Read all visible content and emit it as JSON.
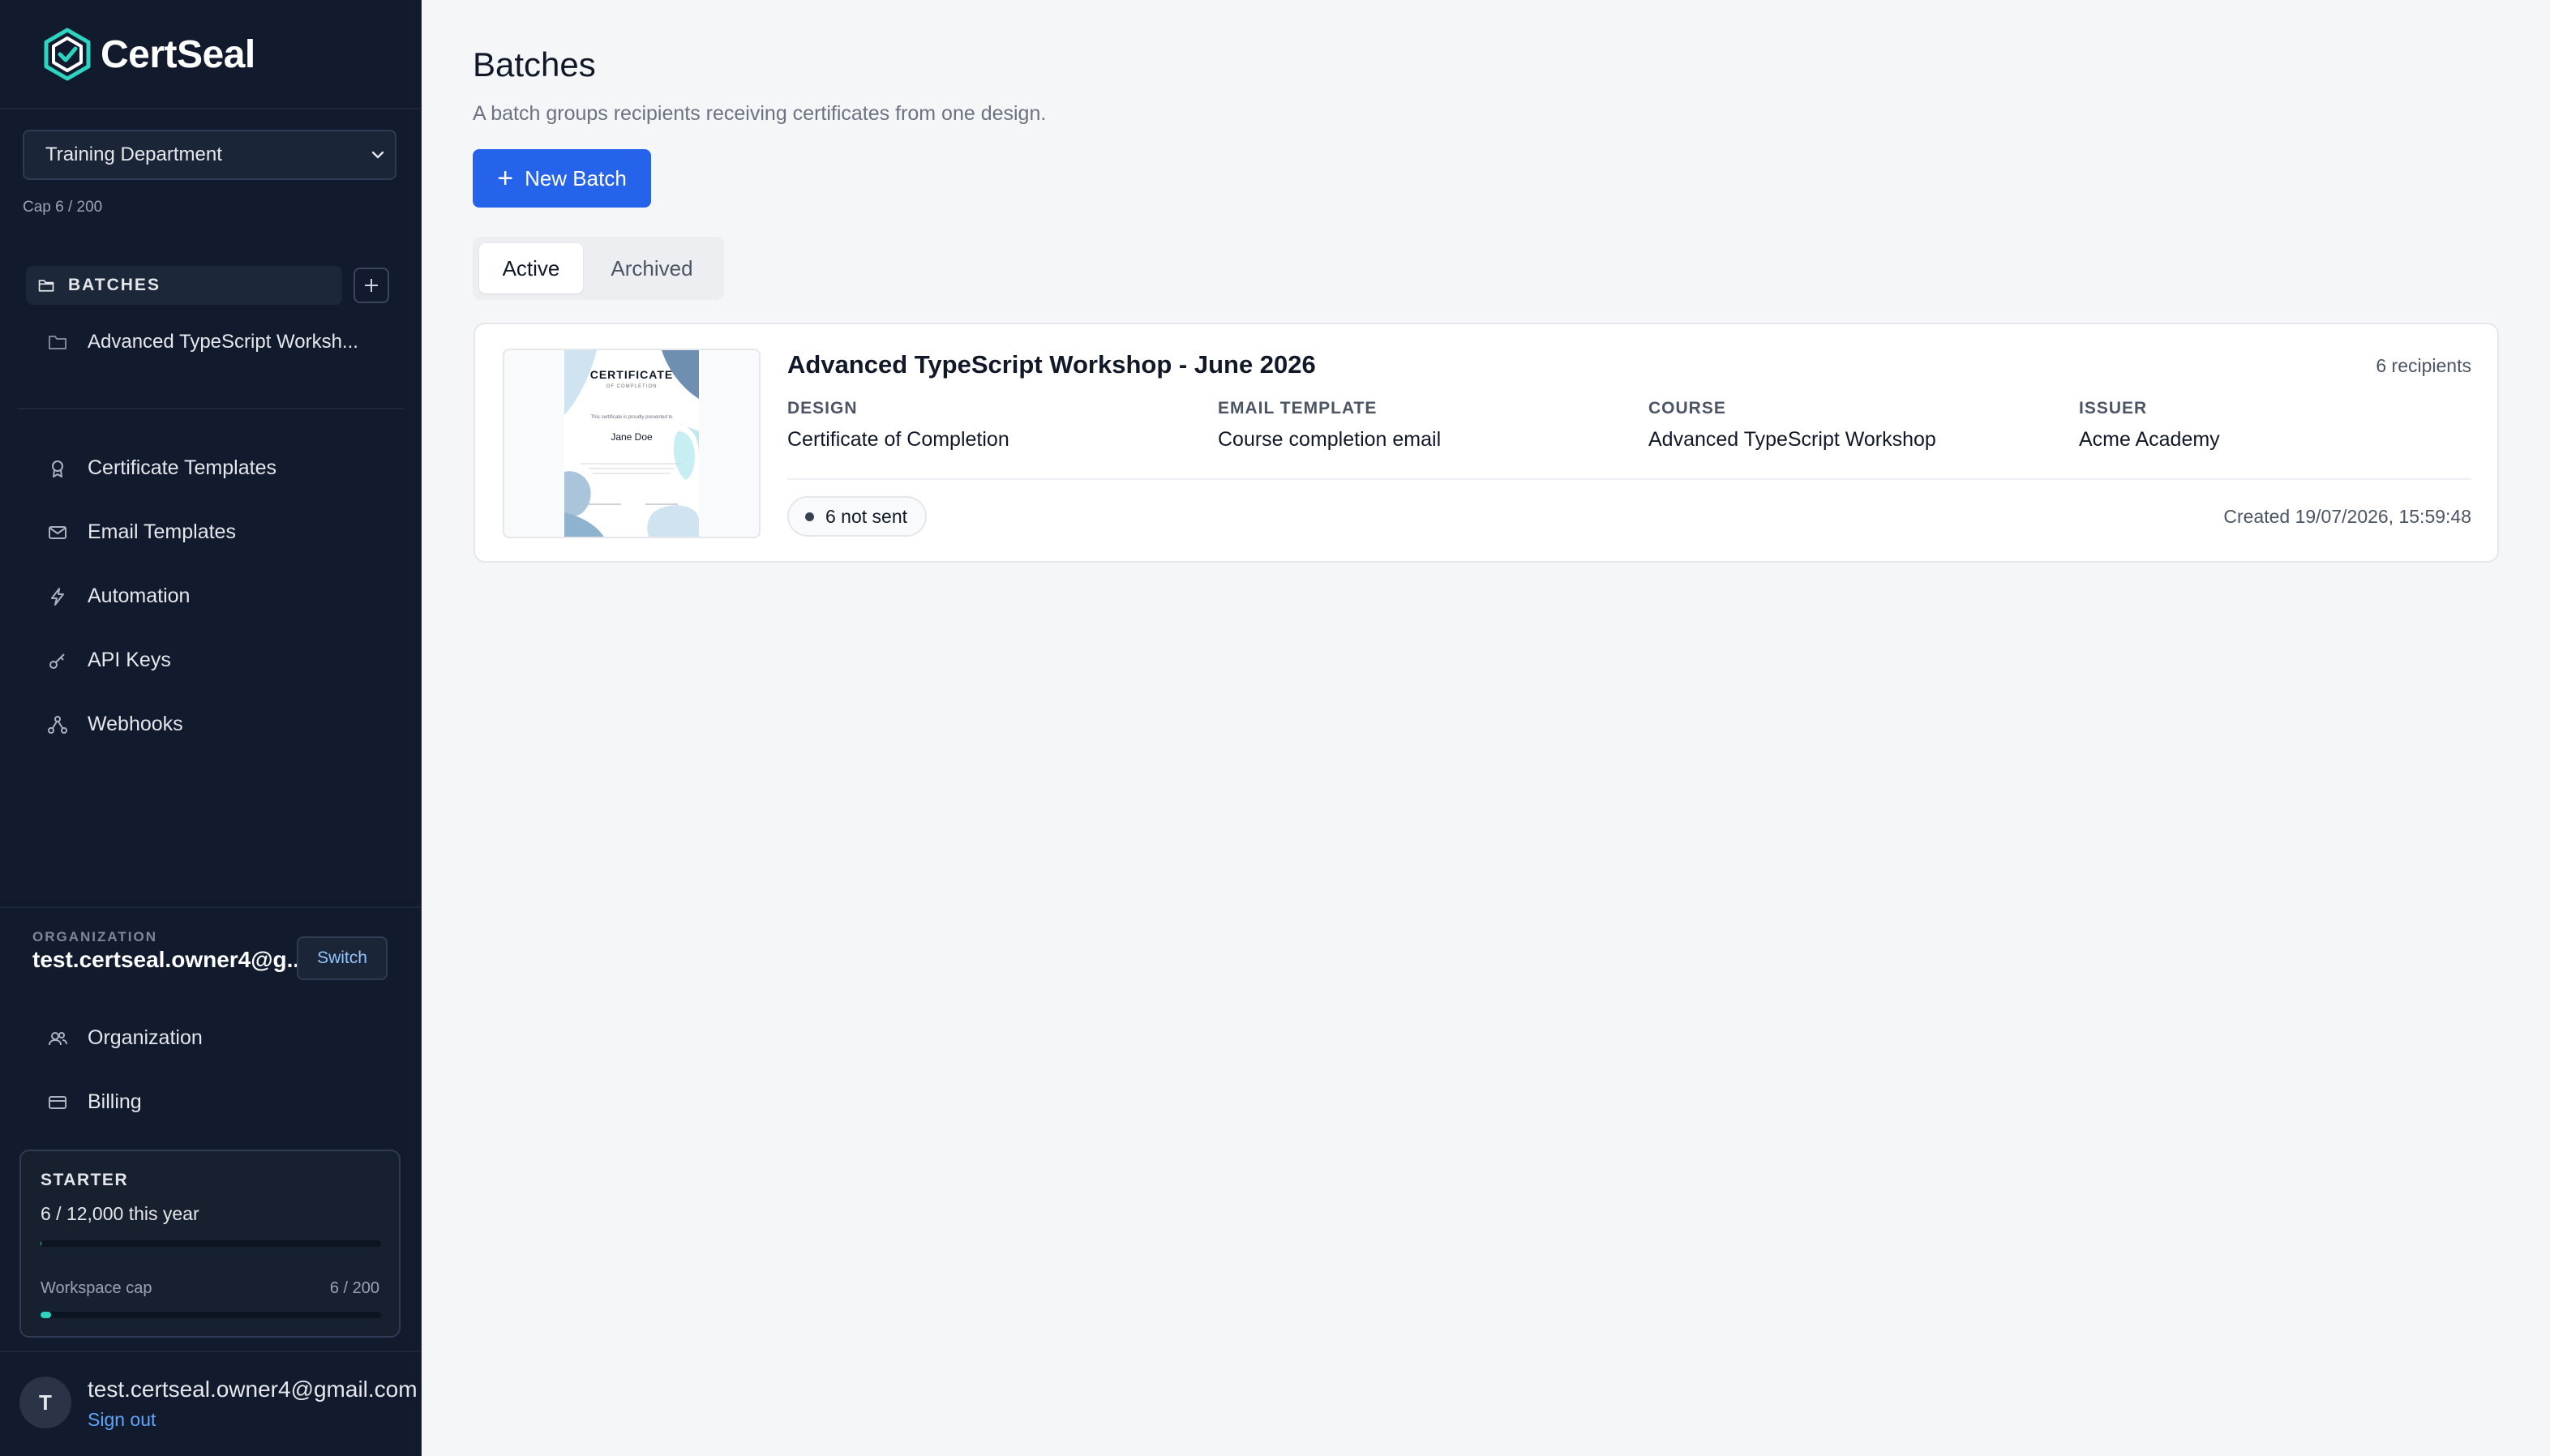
{
  "brand": {
    "name": "CertSeal",
    "logo_icon": "hexagon-check-icon"
  },
  "sidebar": {
    "workspace": {
      "selected": "Training Department",
      "cap": "Cap 6 / 200"
    },
    "batches": {
      "label": "BATCHES",
      "items": [
        {
          "label": "Advanced TypeScript Worksh..."
        }
      ]
    },
    "nav": [
      {
        "label": "Certificate Templates",
        "icon": "award-icon"
      },
      {
        "label": "Email Templates",
        "icon": "mail-icon"
      },
      {
        "label": "Automation",
        "icon": "lightning-icon"
      },
      {
        "label": "API Keys",
        "icon": "key-icon"
      },
      {
        "label": "Webhooks",
        "icon": "webhook-icon"
      }
    ],
    "organization": {
      "label": "ORGANIZATION",
      "name": "test.certseal.owner4@g...",
      "switch_label": "Switch",
      "nav": [
        {
          "label": "Organization",
          "icon": "users-icon"
        },
        {
          "label": "Billing",
          "icon": "credit-card-icon"
        }
      ]
    },
    "plan": {
      "name": "STARTER",
      "usage": "6 / 12,000 this year",
      "usage_fraction": 0.0005,
      "cap_label": "Workspace cap",
      "cap_value": "6 / 200",
      "cap_fraction": 0.03
    },
    "user": {
      "initial": "T",
      "email": "test.certseal.owner4@gmail.com",
      "sign_out": "Sign out"
    }
  },
  "main": {
    "title": "Batches",
    "subtitle": "A batch groups recipients receiving certificates from one design.",
    "new_button": "New Batch",
    "tabs": [
      {
        "label": "Active",
        "active": true
      },
      {
        "label": "Archived",
        "active": false
      }
    ],
    "batches": [
      {
        "title": "Advanced TypeScript Workshop - June 2026",
        "recipients": "6 recipients",
        "fields": [
          {
            "label": "DESIGN",
            "value": "Certificate of Completion"
          },
          {
            "label": "EMAIL TEMPLATE",
            "value": "Course completion email"
          },
          {
            "label": "COURSE",
            "value": "Advanced TypeScript Workshop"
          },
          {
            "label": "ISSUER",
            "value": "Acme Academy"
          }
        ],
        "status": "6 not sent",
        "created": "Created 19/07/2026, 15:59:48",
        "thumbnail": {
          "title": "CERTIFICATE",
          "subtitle": "OF COMPLETION",
          "line": "This certificate is proudly presented to",
          "name": "Jane Doe"
        }
      }
    ]
  },
  "colors": {
    "sidebar_bg": "#111b2d",
    "primary": "#2563eb",
    "accent": "#2dd4bf",
    "link": "#60a5fa"
  }
}
